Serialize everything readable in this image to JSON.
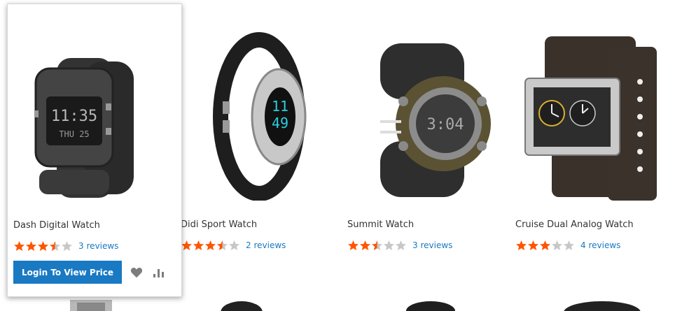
{
  "products": [
    {
      "name": "Dash Digital Watch",
      "rating": 3.5,
      "reviews": "3 reviews",
      "image": "dash-digital-watch-image"
    },
    {
      "name": "Didi Sport Watch",
      "rating": 3.5,
      "reviews": "2 reviews",
      "image": "didi-sport-watch-image"
    },
    {
      "name": "Summit Watch",
      "rating": 2.5,
      "reviews": "3 reviews",
      "image": "summit-watch-image"
    },
    {
      "name": "Cruise Dual Analog Watch",
      "rating": 3,
      "reviews": "4 reviews",
      "image": "cruise-dual-analog-watch-image"
    }
  ],
  "hover_card": {
    "login_label": "Login To View Price",
    "wishlist_icon": "heart-icon",
    "compare_icon": "bar-chart-icon"
  },
  "colors": {
    "star_filled": "#ff5501",
    "star_empty": "#c7c7c7",
    "link": "#1979c3",
    "button": "#1979c3"
  }
}
